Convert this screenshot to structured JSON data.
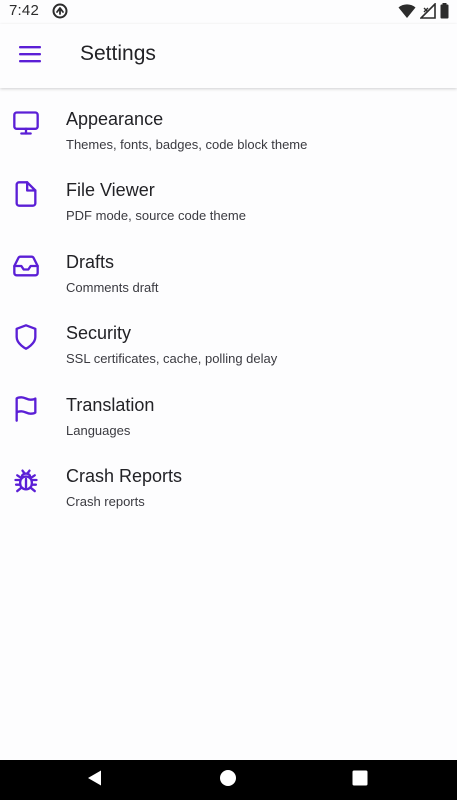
{
  "status_bar": {
    "time": "7:42"
  },
  "app_bar": {
    "title": "Settings"
  },
  "colors": {
    "accent": "#5b1fd6",
    "background": "#fdfdfe",
    "text_primary": "#222226",
    "text_secondary": "#3a3a40",
    "nav_bar": "#000000"
  },
  "settings": {
    "items": [
      {
        "icon": "monitor-icon",
        "title": "Appearance",
        "subtitle": "Themes, fonts, badges, code block theme"
      },
      {
        "icon": "file-icon",
        "title": "File Viewer",
        "subtitle": "PDF mode, source code theme"
      },
      {
        "icon": "inbox-icon",
        "title": "Drafts",
        "subtitle": "Comments draft"
      },
      {
        "icon": "shield-icon",
        "title": "Security",
        "subtitle": "SSL certificates, cache, polling delay"
      },
      {
        "icon": "flag-icon",
        "title": "Translation",
        "subtitle": "Languages"
      },
      {
        "icon": "bug-icon",
        "title": "Crash Reports",
        "subtitle": "Crash reports"
      }
    ]
  },
  "nav_bar": {
    "buttons": [
      "back-icon",
      "home-icon",
      "recents-icon"
    ]
  }
}
